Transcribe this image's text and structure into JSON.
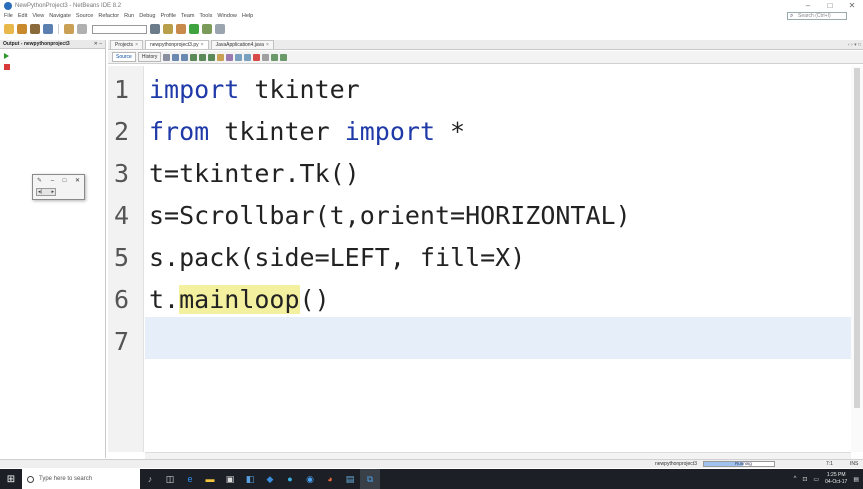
{
  "window": {
    "title": "NewPythonProject3 - NetBeans IDE 8.2",
    "controls": [
      "–",
      "□",
      "✕"
    ]
  },
  "menu": [
    "File",
    "Edit",
    "View",
    "Navigate",
    "Source",
    "Refactor",
    "Run",
    "Debug",
    "Profile",
    "Team",
    "Tools",
    "Window",
    "Help"
  ],
  "search": {
    "placeholder": "Search (Ctrl+I)"
  },
  "output_panel": {
    "tab_label": "Output - newpythonproject3",
    "controls": "✕  –"
  },
  "tk_window": {
    "controls": [
      "–",
      "□",
      "✕"
    ],
    "scroll_left": "◂|",
    "scroll_right": "▸"
  },
  "doc_tabs": [
    {
      "label": "Projects",
      "active": false
    },
    {
      "label": "newpythonproject3.py",
      "active": true
    },
    {
      "label": "JavaApplication4.java",
      "active": false
    }
  ],
  "editor": {
    "source_label": "Source",
    "history_label": "History",
    "line_numbers": [
      "1",
      "2",
      "3",
      "4",
      "5",
      "6",
      "7"
    ],
    "lines": [
      {
        "kw1": "import",
        "rest1": " tkinter"
      },
      {
        "kw1": "from",
        "mid": " tkinter ",
        "kw2": "import",
        "rest2": " *"
      },
      {
        "text": "t=tkinter.Tk()"
      },
      {
        "text": "s=Scrollbar(t,orient=HORIZONTAL)"
      },
      {
        "text": "s.pack(side=LEFT, fill=X)"
      },
      {
        "pre": "t.",
        "hl": "mainloop",
        "post": "()"
      },
      {
        "text": ""
      }
    ]
  },
  "status_bar": {
    "project": "newpythonproject3",
    "run_status": "Running",
    "progress": 0.55,
    "position": "7:1",
    "mode": "INS"
  },
  "taskbar": {
    "search_placeholder": "Type here to search",
    "time": "1:25 PM",
    "date": "04-Oct-17"
  },
  "colors": {
    "keyword": "#1f3aa8",
    "highlight": "#f3f0a0",
    "current_line": "#e6eef9",
    "taskbar": "#1c2026"
  }
}
